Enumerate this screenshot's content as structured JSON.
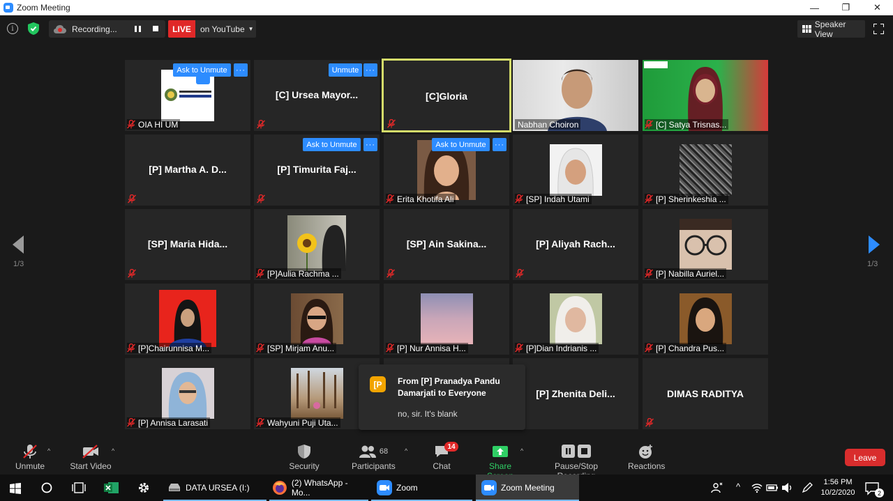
{
  "window": {
    "title": "Zoom Meeting",
    "minimize": "—",
    "maximize": "❐",
    "close": "✕"
  },
  "topbar": {
    "recording_text": "Recording...",
    "live_label": "LIVE",
    "youtube_label": "on YouTube",
    "speaker_view_label": "Speaker View"
  },
  "pagination": {
    "left": "1/3",
    "right": "1/3"
  },
  "tiles": [
    {
      "name": "OIA HI UM",
      "ask": "Ask to Unmute",
      "more": "···"
    },
    {
      "center": "[C] Ursea Mayor...",
      "ask": "Unmute",
      "more": "···"
    },
    {
      "center": "[C]Gloria"
    },
    {
      "name": "Nabhan Choiron"
    },
    {
      "name": "[C] Satya Trisnas..."
    },
    {
      "center": "[P] Martha A. D..."
    },
    {
      "center": "[P] Timurita Faj...",
      "ask": "Ask to Unmute",
      "more": "···"
    },
    {
      "name": "Erita Khotifa Ali",
      "ask": "Ask to Unmute",
      "more": "···"
    },
    {
      "name": "[SP] Indah Utami"
    },
    {
      "name": "[P] Sherinkeshia ..."
    },
    {
      "center": "[SP] Maria Hida..."
    },
    {
      "name": "[P]Aulia Rachma ..."
    },
    {
      "center": "[SP] Ain Sakina..."
    },
    {
      "center": "[P] Aliyah Rach..."
    },
    {
      "name": "[P] Nabilla Auriel..."
    },
    {
      "name": "[P]Chairunnisa M..."
    },
    {
      "name": "[SP] Mirjam Anu..."
    },
    {
      "name": "[P] Nur Annisa H..."
    },
    {
      "name": "[P]Dian Indrianis ..."
    },
    {
      "name": "[P] Chandra Pus..."
    },
    {
      "name": "[P] Annisa Larasati"
    },
    {
      "name": "Wahyuni Puji Uta..."
    },
    {
      "center": "[P] Zhenita Deli..."
    },
    {
      "center": "DIMAS RADITYA"
    }
  ],
  "chat_popup": {
    "avatar": "[P",
    "from": "From [P] Pranadya Pandu Damarjati to Everyone",
    "message": "no, sir. It's blank"
  },
  "toolbar": {
    "unmute": "Unmute",
    "start_video": "Start Video",
    "security": "Security",
    "participants": "Participants",
    "participants_count": "68",
    "chat": "Chat",
    "chat_badge": "14",
    "share_screen": "Share Screen",
    "pause_stop": "Pause/Stop Recording",
    "reactions": "Reactions",
    "leave": "Leave"
  },
  "taskbar": {
    "data_ursea": "DATA URSEA (I:)",
    "whatsapp": "(2) WhatsApp - Mo...",
    "zoom": "Zoom",
    "zoom_meeting": "Zoom Meeting",
    "time": "1:56 PM",
    "date": "10/2/2020",
    "notif_count": "2"
  },
  "colors": {
    "accent_blue": "#2d8cff",
    "live_red": "#e02828",
    "active_border": "#d4dc6a",
    "share_green": "#2fcf65"
  }
}
